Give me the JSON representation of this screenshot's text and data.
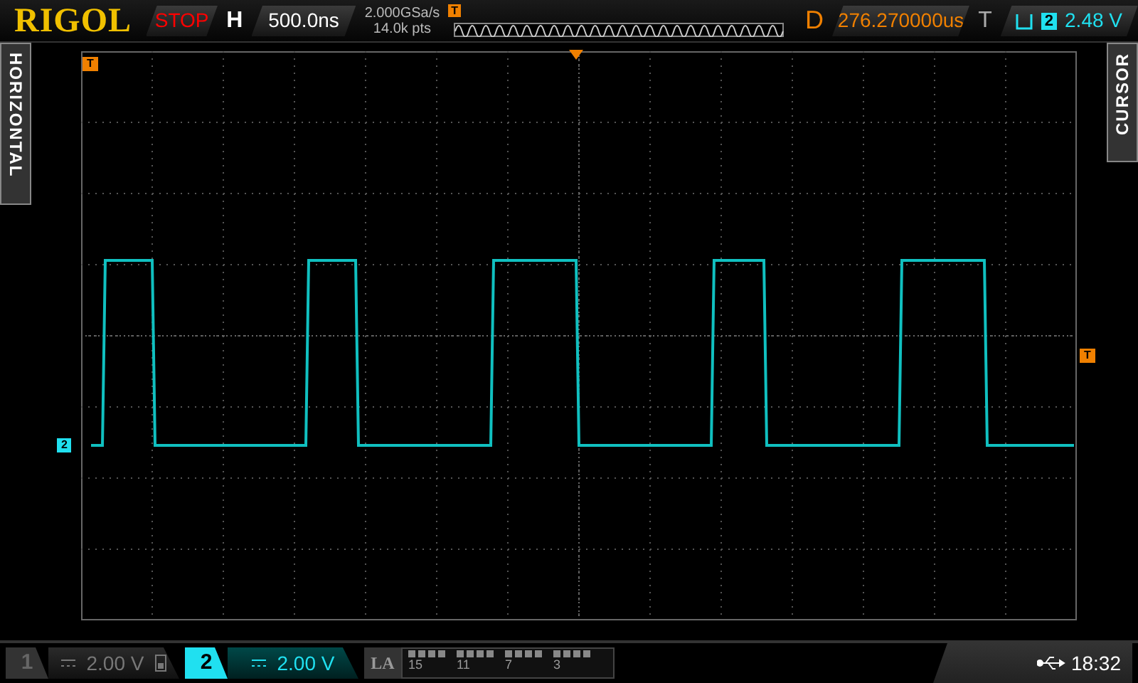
{
  "brand": "RIGOL",
  "run_state": "STOP",
  "horizontal": {
    "label": "H",
    "timebase": "500.0ns"
  },
  "acquisition": {
    "sample_rate": "2.000GSa/s",
    "memory_depth": "14.0k pts"
  },
  "memory_overview": {
    "trigger_marker": "T"
  },
  "delay": {
    "label": "D",
    "value": "276.270000us"
  },
  "trigger": {
    "label": "T",
    "source": "2",
    "level": "2.48 V"
  },
  "side_tabs": [
    {
      "kind": "left",
      "label": "HORIZONTAL"
    },
    {
      "kind": "right",
      "label": "CURSOR"
    }
  ],
  "markers": {
    "trigger_position": "T",
    "trigger_level": "T",
    "channel": "2"
  },
  "channels": [
    {
      "number": "1",
      "scale": "2.00 V",
      "selected": false,
      "indicator": true
    },
    {
      "number": "2",
      "scale": "2.00 V",
      "selected": true,
      "indicator": false
    }
  ],
  "logic_analyzer": {
    "label": "LA",
    "bit_labels": [
      "15",
      "11",
      "7",
      "3"
    ]
  },
  "status_bar": {
    "time": "18:32"
  }
}
